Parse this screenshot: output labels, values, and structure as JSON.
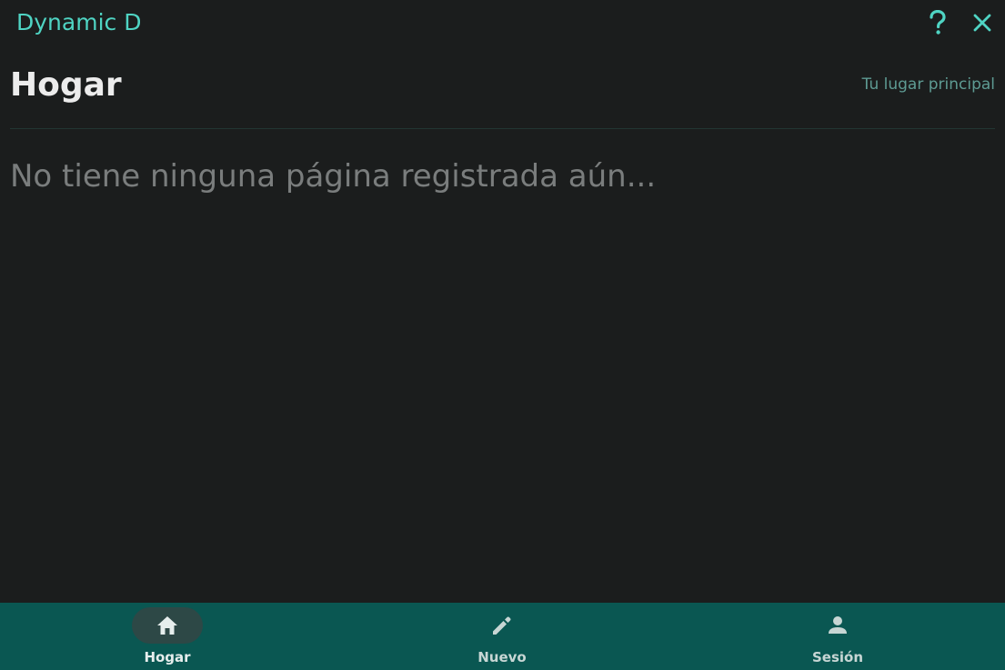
{
  "app": {
    "title": "Dynamic D"
  },
  "window_controls": {
    "help_icon": "help-icon",
    "close_icon": "close-icon"
  },
  "header": {
    "title": "Hogar",
    "subtitle": "Tu lugar principal"
  },
  "main": {
    "empty_message": "No tiene ninguna página registrada aún..."
  },
  "bottom_nav": {
    "items": [
      {
        "label": "Hogar",
        "icon": "home-icon",
        "active": true
      },
      {
        "label": "Nuevo",
        "icon": "pencil-icon",
        "active": false
      },
      {
        "label": "Sesión",
        "icon": "person-icon",
        "active": false
      }
    ]
  },
  "colors": {
    "background": "#1b1d1d",
    "accent": "#4fd4c3",
    "nav_background": "#0a5752",
    "nav_active_pill": "#2d4846",
    "subtitle": "#5e9b93"
  }
}
